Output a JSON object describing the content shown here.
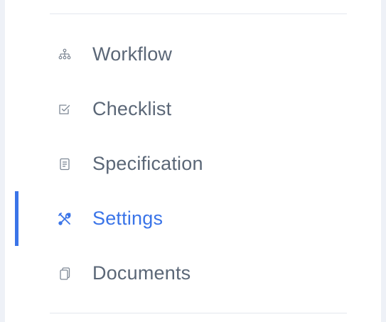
{
  "sidebar": {
    "items": [
      {
        "label": "Workflow",
        "icon": "workflow-icon",
        "active": false
      },
      {
        "label": "Checklist",
        "icon": "checklist-icon",
        "active": false
      },
      {
        "label": "Specification",
        "icon": "document-icon",
        "active": false
      },
      {
        "label": "Settings",
        "icon": "settings-tools-icon",
        "active": true
      },
      {
        "label": "Documents",
        "icon": "documents-icon",
        "active": false
      }
    ]
  },
  "colors": {
    "accent": "#3a74e8",
    "text": "#5b6777",
    "icon": "#7d8794",
    "divider": "#e3e7ee"
  }
}
